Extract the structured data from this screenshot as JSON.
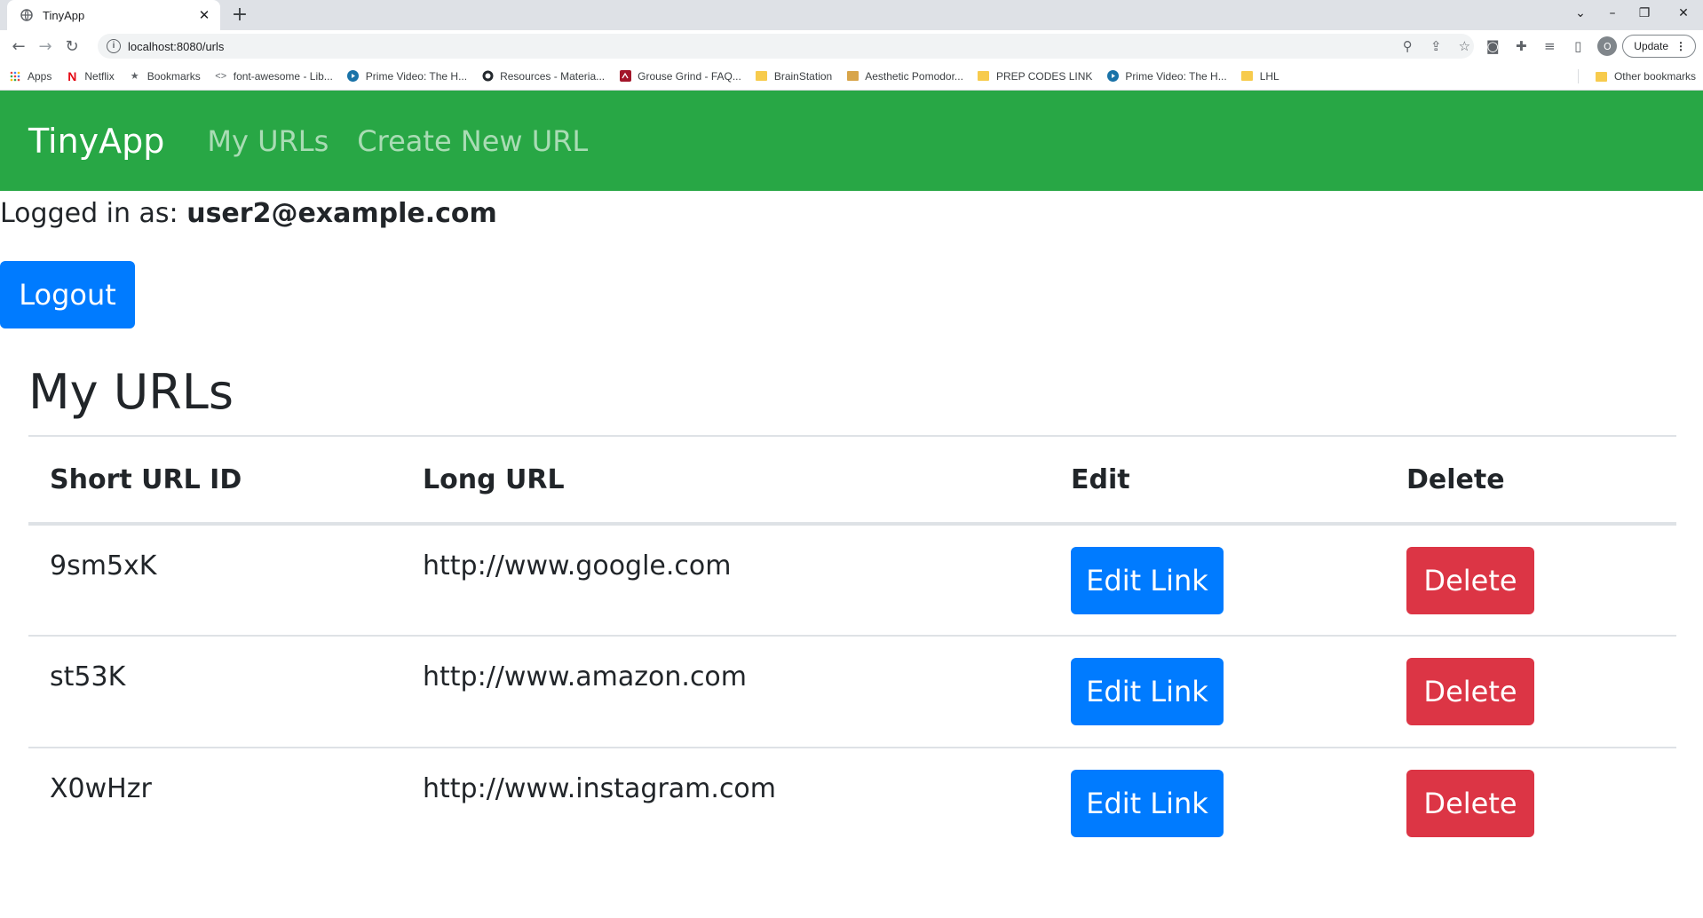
{
  "browser": {
    "tab_title": "TinyApp",
    "url": "localhost:8080/urls",
    "update_label": "Update",
    "avatar_letter": "O",
    "bookmarks": [
      {
        "label": "Apps",
        "icon": "apps-grid-icon"
      },
      {
        "label": "Netflix",
        "icon": "netflix-icon"
      },
      {
        "label": "Bookmarks",
        "icon": "star-icon"
      },
      {
        "label": "font-awesome - Lib...",
        "icon": "code-icon"
      },
      {
        "label": "Prime Video: The H...",
        "icon": "prime-video-icon"
      },
      {
        "label": "Resources - Materia...",
        "icon": "github-icon"
      },
      {
        "label": "Grouse Grind - FAQ...",
        "icon": "grouse-grind-icon"
      },
      {
        "label": "BrainStation",
        "icon": "folder-icon"
      },
      {
        "label": "Aesthetic Pomodor...",
        "icon": "folder-icon"
      },
      {
        "label": "PREP CODES LINK",
        "icon": "folder-icon"
      },
      {
        "label": "Prime Video: The H...",
        "icon": "prime-video-icon"
      },
      {
        "label": "LHL",
        "icon": "folder-icon"
      }
    ],
    "other_bookmarks": "Other bookmarks"
  },
  "navbar": {
    "brand": "TinyApp",
    "links": [
      "My URLs",
      "Create New URL"
    ],
    "color": "#28a745"
  },
  "user": {
    "prefix": "Logged in as:",
    "email": "user2@example.com",
    "logout_label": "Logout"
  },
  "main": {
    "heading": "My URLs",
    "columns": [
      "Short URL ID",
      "Long URL",
      "Edit",
      "Delete"
    ],
    "rows": [
      {
        "id": "9sm5xK",
        "long_url": "http://www.google.com",
        "edit_label": "Edit Link",
        "delete_label": "Delete"
      },
      {
        "id": "st53K",
        "long_url": "http://www.amazon.com",
        "edit_label": "Edit Link",
        "delete_label": "Delete"
      },
      {
        "id": "X0wHzr",
        "long_url": "http://www.instagram.com",
        "edit_label": "Edit Link",
        "delete_label": "Delete"
      }
    ]
  },
  "colors": {
    "primary": "#007bff",
    "danger": "#dc3545"
  }
}
